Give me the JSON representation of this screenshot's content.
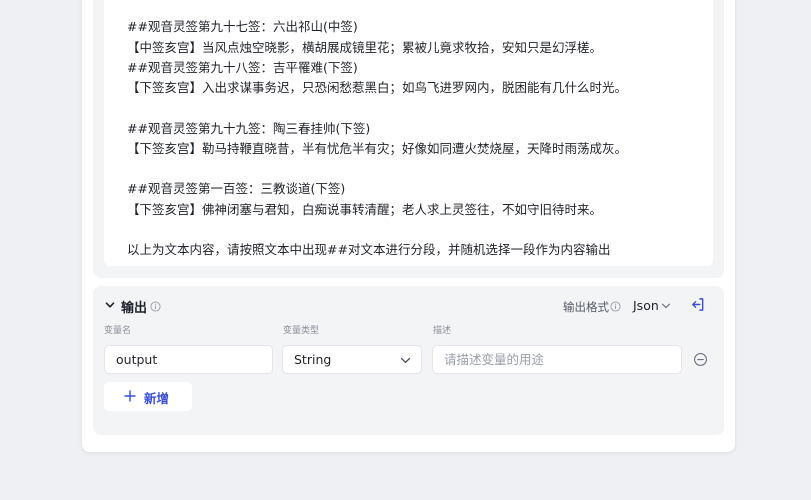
{
  "prompt": {
    "lines": [
      "##观音灵签第九十七签：六出祁山(中签)",
      "【中签亥宫】当风点烛空晓影，横胡展成镜里花；累被儿竟求牧拾，安知只是幻浮槎。",
      "##观音灵签第九十八签：吉平罹难(下签)",
      "【下签亥宫】入出求谋事务迟，只恐闲愁惹黑白；如鸟飞进罗网内，脱困能有几什么时光。",
      "",
      "##观音灵签第九十九签：陶三春挂帅(下签)",
      "【下签亥宫】勒马持鞭直晓昔，半有忧危半有灾；好像如同遭火焚烧屋，天降时雨荡成灰。",
      "",
      "##观音灵签第一百签：三教谈道(下签)",
      "【下签亥宫】佛神闭塞与君知，白痴说事转清醒；老人求上灵签往，不如守旧待时来。",
      "",
      "以上为文本内容，请按照文本中出现##对文本进行分段，并随机选择一段作为内容输出"
    ]
  },
  "output": {
    "title": "输出",
    "format_label": "输出格式",
    "format_value": "Json",
    "columns": {
      "name": "变量名",
      "type": "变量类型",
      "desc": "描述"
    },
    "variable": {
      "name": "output",
      "type": "String",
      "desc_placeholder": "请描述变量的用途"
    },
    "add_label": "新增"
  },
  "colors": {
    "accent": "#3b4fd8",
    "page_bg": "#eef0f4",
    "section_bg": "#f3f4f6"
  },
  "icons": {
    "collapse": "chevron-down-icon",
    "info": "info-icon",
    "dropdown": "chevron-down-icon",
    "exit": "exit-to-left-icon",
    "remove": "minus-circle-icon",
    "add": "plus-icon"
  }
}
